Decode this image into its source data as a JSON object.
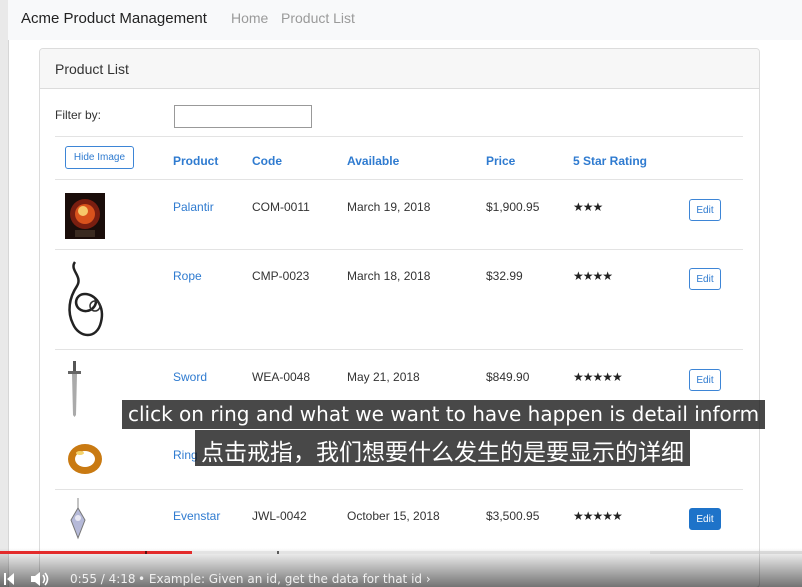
{
  "navbar": {
    "brand": "Acme Product Management",
    "links": [
      "Home",
      "Product List"
    ]
  },
  "card": {
    "title": "Product List",
    "filter_label": "Filter by:",
    "filter_value": "",
    "hide_image_label": "Hide Image",
    "columns": [
      "Product",
      "Code",
      "Available",
      "Price",
      "5 Star Rating"
    ],
    "rows": [
      {
        "name": "Palantir",
        "code": "COM-0011",
        "available": "March 19, 2018",
        "price": "$1,900.95",
        "rating": 3.2,
        "stars": "★★★",
        "edit": "Edit",
        "thumb": "palantir-orb"
      },
      {
        "name": "Rope",
        "code": "CMP-0023",
        "available": "March 18, 2018",
        "price": "$32.99",
        "rating": 4.2,
        "stars": "★★★★",
        "edit": "Edit",
        "thumb": "rope-coil"
      },
      {
        "name": "Sword",
        "code": "WEA-0048",
        "available": "May 21, 2018",
        "price": "$849.90",
        "rating": 5,
        "stars": "★★★★★",
        "edit": "Edit",
        "thumb": "sword"
      },
      {
        "name": "Ring",
        "thumb": "gold-ring"
      },
      {
        "name": "Evenstar",
        "code": "JWL-0042",
        "available": "October 15, 2018",
        "price": "$3,500.95",
        "rating": 5,
        "stars": "★★★★★",
        "edit": "Edit",
        "thumb": "evenstar-pendant"
      }
    ]
  },
  "captions": {
    "english": "click on ring and what we want to have happen is detail inform",
    "chinese": "点击戒指，我们想要什么发生的是要显示的详细"
  },
  "player": {
    "time": "0:55 / 4:18",
    "chapter": "• Example: Given an id, get the data for that id",
    "played_fraction": 0.24,
    "loaded_fraction": 0.81
  },
  "colors": {
    "link": "#2f7bd0",
    "active_button": "#1e73c9",
    "progress": "#e32b2b"
  }
}
